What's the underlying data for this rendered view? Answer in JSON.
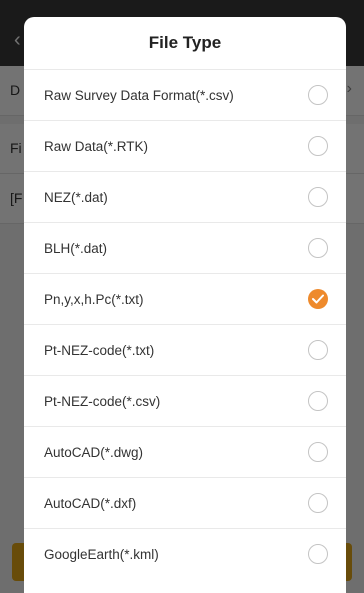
{
  "background": {
    "back_glyph": "‹",
    "rows": [
      {
        "text": "D"
      },
      {
        "text": "Fi"
      },
      {
        "text": "[F"
      }
    ],
    "chevron_glyph": "›"
  },
  "dialog": {
    "title": "File Type",
    "options": [
      {
        "label": "Raw Survey Data Format(*.csv)",
        "selected": false
      },
      {
        "label": "Raw Data(*.RTK)",
        "selected": false
      },
      {
        "label": "NEZ(*.dat)",
        "selected": false
      },
      {
        "label": "BLH(*.dat)",
        "selected": false
      },
      {
        "label": "Pn,y,x,h.Pc(*.txt)",
        "selected": true
      },
      {
        "label": "Pt-NEZ-code(*.txt)",
        "selected": false
      },
      {
        "label": "Pt-NEZ-code(*.csv)",
        "selected": false
      },
      {
        "label": "AutoCAD(*.dwg)",
        "selected": false
      },
      {
        "label": "AutoCAD(*.dxf)",
        "selected": false
      },
      {
        "label": "GoogleEarth(*.kml)",
        "selected": false
      }
    ]
  },
  "colors": {
    "accent": "#ee8a2c",
    "header": "#3b3b3b",
    "bottom_button": "#e6a817"
  },
  "icons": {
    "selected": "check-icon",
    "unselected": "radio-empty-icon"
  }
}
